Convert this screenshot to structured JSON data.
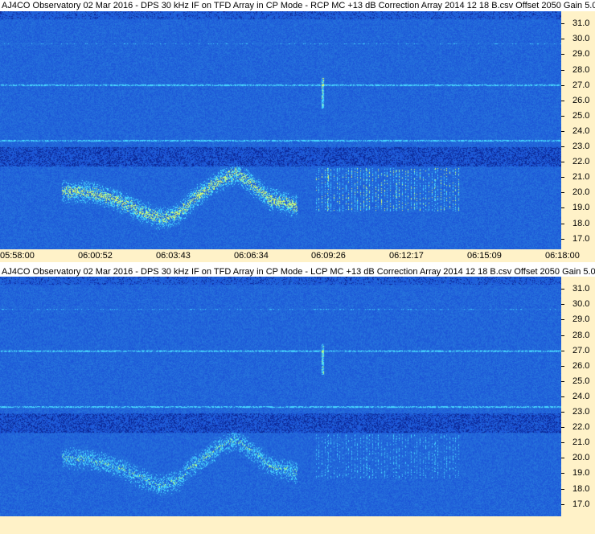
{
  "chart_data": [
    {
      "type": "heatmap",
      "title": "AJ4CO Observatory 02 Mar 2016 - DPS 30 kHz IF on TFD Array in CP Mode - RCP  MC +13 dB  Correction Array 2014 12 18 B.csv  Offset 2050  Gain 5.0",
      "polarization": "RCP",
      "y_ticks": [
        "31.0",
        "30.0",
        "29.0",
        "28.0",
        "27.0",
        "26.0",
        "25.0",
        "24.0",
        "23.0",
        "22.0",
        "21.0",
        "20.0",
        "19.0",
        "18.0",
        "17.0"
      ],
      "ylim": [
        16.3,
        31.8
      ],
      "x_ticks": [
        "05:58:00",
        "06:00:52",
        "06:03:43",
        "06:06:34",
        "06:09:26",
        "06:12:17",
        "06:15:09",
        "06:18:00"
      ],
      "colors": {
        "background": "#1a4fd6",
        "hot": "#d8ff70",
        "cyan": "#48d8ff",
        "dark": "#0c2a9a"
      }
    },
    {
      "type": "heatmap",
      "title": "AJ4CO Observatory 02 Mar 2016 - DPS 30 kHz IF on TFD Array in CP Mode - LCP  MC +13 dB  Correction Array 2014 12 18 B.csv  Offset 2050  Gain 5.0",
      "polarization": "LCP",
      "y_ticks": [
        "31.0",
        "30.0",
        "29.0",
        "28.0",
        "27.0",
        "26.0",
        "25.0",
        "24.0",
        "23.0",
        "22.0",
        "21.0",
        "20.0",
        "19.0",
        "18.0",
        "17.0"
      ],
      "ylim": [
        16.3,
        31.8
      ],
      "x_ticks": [],
      "colors": {
        "background": "#1a4fd6",
        "hot": "#b8ff80",
        "cyan": "#48d8ff",
        "dark": "#0c2a9a"
      }
    }
  ]
}
